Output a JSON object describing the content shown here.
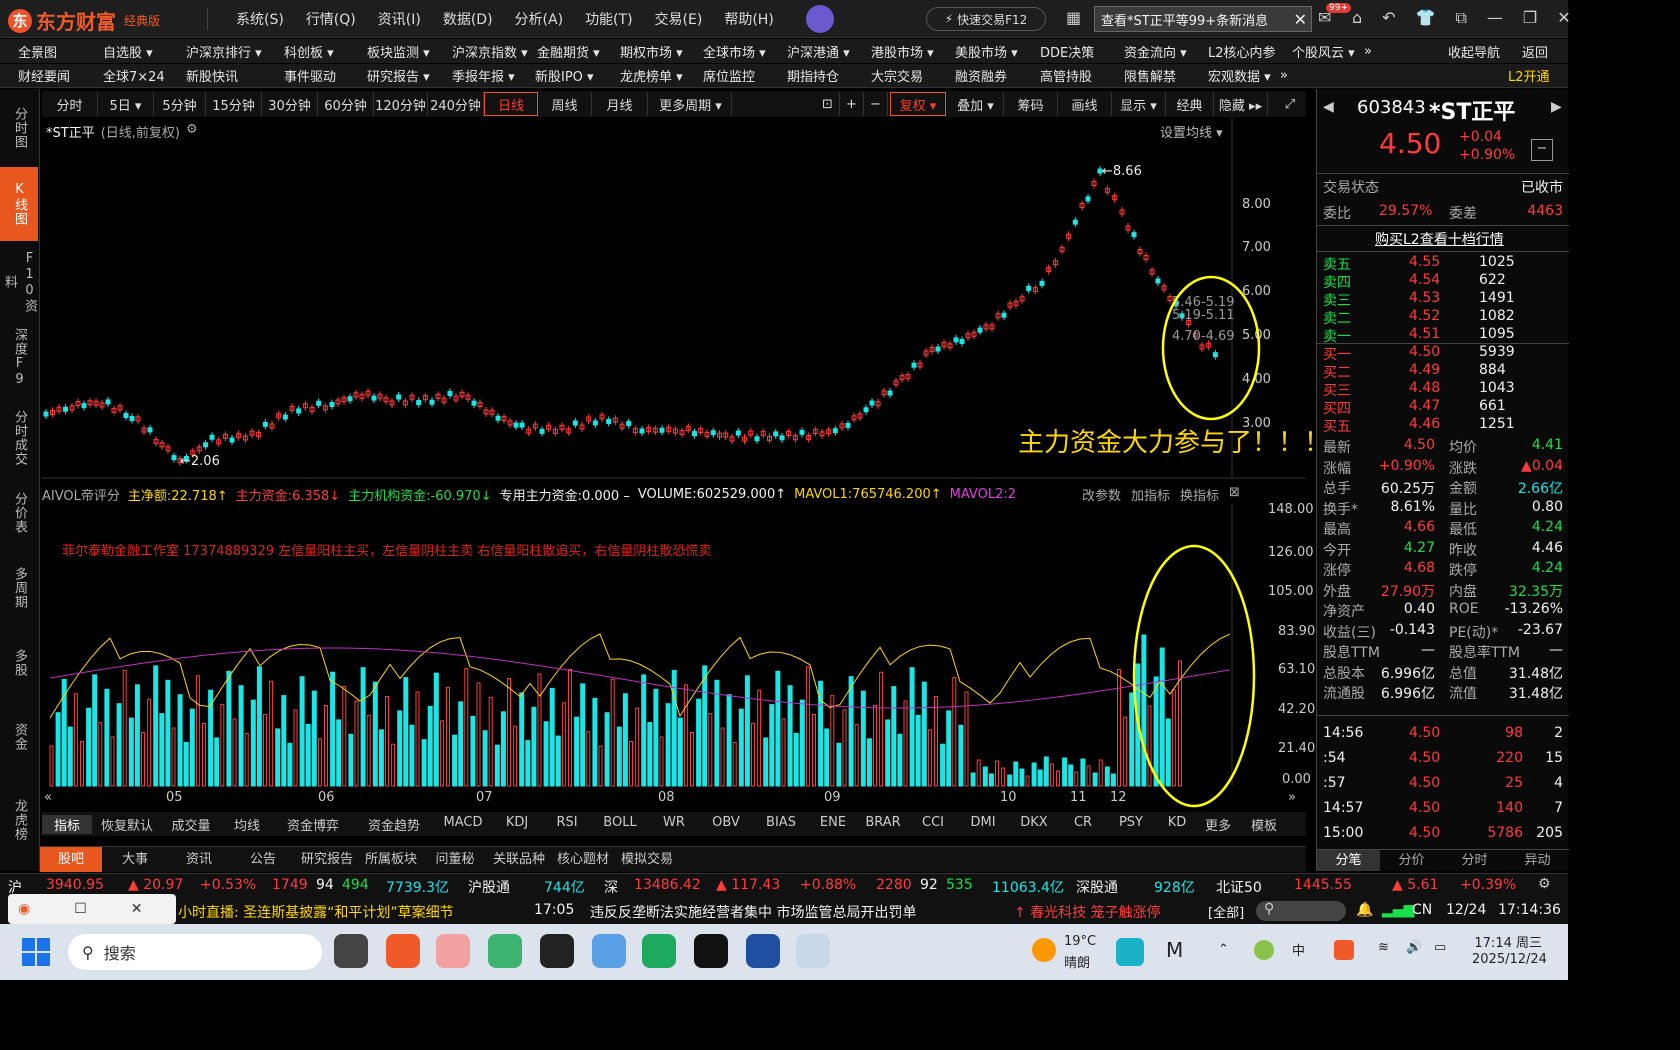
{
  "app": {
    "brand": "东方财富",
    "edition": "经典版",
    "logo_char": "东"
  },
  "menu": [
    "系统(S)",
    "行情(Q)",
    "资讯(I)",
    "数据(D)",
    "分析(A)",
    "功能(T)",
    "交易(E)",
    "帮助(H)"
  ],
  "quick_trade": "快速交易F12",
  "news_button": "查看*ST正平等99+条新消息",
  "mail_badge": "99+",
  "nav_row1": [
    "全景图",
    "自选股 ▾",
    "沪深京排行 ▾",
    "科创板 ▾",
    "板块监测 ▾",
    "沪深京指数 ▾",
    "金融期货 ▾",
    "期权市场 ▾",
    "全球市场 ▾",
    "沪深港通 ▾",
    "港股市场 ▾",
    "美股市场 ▾",
    "DDE决策",
    "资金流向 ▾",
    "L2核心内参",
    "个股风云 ▾",
    "»",
    "收起导航",
    "返回"
  ],
  "nav_row2": [
    "财经要闻",
    "全球7×24",
    "新股快讯",
    "事件驱动",
    "研究报告 ▾",
    "季报年报 ▾",
    "新股IPO ▾",
    "龙虎榜单 ▾",
    "席位监控",
    "期指持仓",
    "大宗交易",
    "融资融券",
    "高管持股",
    "限售解禁",
    "宏观数据 ▾",
    "»",
    "L2开通"
  ],
  "left_sidebar": [
    "分时图",
    "K线图",
    "F10资料",
    "深度F9",
    "分时成交",
    "分价表",
    "多周期",
    "多股",
    "资金",
    "龙虎榜"
  ],
  "period_bar": [
    "分时",
    "5日 ▾",
    "5分钟",
    "15分钟",
    "30分钟",
    "60分钟",
    "120分钟",
    "240分钟",
    "日线",
    "周线",
    "月线",
    "更多周期 ▾"
  ],
  "tool_bar": [
    "复权 ▾",
    "叠加 ▾",
    "筹码",
    "画线",
    "显示 ▾",
    "经典",
    "隐藏 ▸▸"
  ],
  "chart_header": {
    "name": "*ST正平",
    "mode": "(日线,前复权)",
    "ma_setting": "设置均线 ▾"
  },
  "kline": {
    "high_label": "8.66",
    "low_label": "2.06",
    "price_ticks": [
      "8.00",
      "7.00",
      "6.00",
      "5.00",
      "4.00",
      "3.00"
    ],
    "box_labels": [
      "5.46-5.19",
      "5.19-5.11",
      "4.70-4.69"
    ],
    "annotation": "主力资金大力参与了！！！！！"
  },
  "indicator": {
    "name": "AIVOL帝评分",
    "items": [
      {
        "label": "主净额:22.718↑",
        "color": "#ffd700"
      },
      {
        "label": "主力资金:6.358↓",
        "color": "#ff3b3b"
      },
      {
        "label": "主力机构资金:-60.970↓",
        "color": "#18e04a"
      },
      {
        "label": "专用主力资金:0.000 –",
        "color": "#f2f2f2"
      },
      {
        "label": "VOLUME:602529.000↑",
        "color": "#f2f2f2"
      },
      {
        "label": "MAVOL1:765746.200↑",
        "color": "#ffd700"
      },
      {
        "label": "MAVOL2:2",
        "color": "#e63ce6"
      }
    ],
    "actions": [
      "改参数",
      "加指标",
      "换指标"
    ],
    "watermark": "菲尔泰勒金融工作室 17374889329 左信量阳柱主买，左信量阴柱主卖 右信量阳柱散追买，右信量阴柱散恐慌卖",
    "vol_ticks": [
      "148.00",
      "126.00",
      "105.00",
      "83.90",
      "63.10",
      "42.20",
      "21.40",
      "0.00"
    ],
    "month_labels": [
      "05",
      "06",
      "07",
      "08",
      "09",
      "10",
      "11",
      "12"
    ]
  },
  "indicator_tabs": [
    "指标",
    "恢复默认",
    "成交量",
    "均线",
    "资金博弈",
    "资金趋势",
    "MACD",
    "KDJ",
    "RSI",
    "BOLL",
    "WR",
    "OBV",
    "BIAS",
    "ENE",
    "BRAR",
    "CCI",
    "DMI",
    "DKX",
    "CR",
    "PSY",
    "KD",
    "更多",
    "模板"
  ],
  "bottom_tabs": [
    "股吧",
    "大事",
    "资讯",
    "公告",
    "研究报告",
    "所属板块",
    "问董秘",
    "关联品种",
    "核心题材",
    "模拟交易"
  ],
  "quote": {
    "code": "603843",
    "name": "*ST正平",
    "price": "4.50",
    "change": "+0.04",
    "change_pct": "+0.90%",
    "status_label": "交易状态",
    "status": "已收市",
    "weibi_label": "委比",
    "weibi": "29.57%",
    "weicha_label": "委差",
    "weicha": "4463",
    "l2_link": "购买L2查看十档行情",
    "asks": [
      {
        "l": "卖五",
        "p": "4.55",
        "v": "1025"
      },
      {
        "l": "卖四",
        "p": "4.54",
        "v": "622"
      },
      {
        "l": "卖三",
        "p": "4.53",
        "v": "1491"
      },
      {
        "l": "卖二",
        "p": "4.52",
        "v": "1082"
      },
      {
        "l": "卖一",
        "p": "4.51",
        "v": "1095"
      }
    ],
    "bids": [
      {
        "l": "买一",
        "p": "4.50",
        "v": "5939"
      },
      {
        "l": "买二",
        "p": "4.49",
        "v": "884"
      },
      {
        "l": "买三",
        "p": "4.48",
        "v": "1043"
      },
      {
        "l": "买四",
        "p": "4.47",
        "v": "661"
      },
      {
        "l": "买五",
        "p": "4.46",
        "v": "1251"
      }
    ],
    "stats": [
      [
        "最新",
        "4.50",
        "red",
        "均价",
        "4.41",
        "green"
      ],
      [
        "涨幅",
        "+0.90%",
        "red",
        "涨跌",
        "▲0.04",
        "red"
      ],
      [
        "总手",
        "60.25万",
        "white",
        "金额",
        "2.66亿",
        "cyan"
      ],
      [
        "换手*",
        "8.61%",
        "white",
        "量比",
        "0.80",
        "white"
      ],
      [
        "最高",
        "4.66",
        "red",
        "最低",
        "4.24",
        "green"
      ],
      [
        "今开",
        "4.27",
        "green",
        "昨收",
        "4.46",
        "white"
      ],
      [
        "涨停",
        "4.68",
        "red",
        "跌停",
        "4.24",
        "green"
      ],
      [
        "外盘",
        "27.90万",
        "red",
        "内盘",
        "32.35万",
        "green"
      ],
      [
        "净资产",
        "0.40",
        "white",
        "ROE",
        "-13.26%",
        "white"
      ],
      [
        "收益(三)",
        "-0.143",
        "white",
        "PE(动)*",
        "-23.67",
        "white"
      ],
      [
        "股息TTM",
        "—",
        "white",
        "股息率TTM",
        "—",
        "white"
      ],
      [
        "总股本",
        "6.996亿",
        "white",
        "总值",
        "31.48亿",
        "white"
      ],
      [
        "流通股",
        "6.996亿",
        "white",
        "流值",
        "31.48亿",
        "white"
      ]
    ],
    "ticks": [
      [
        "14:56",
        "4.50",
        "98",
        "2"
      ],
      [
        ":54",
        "4.50",
        "220",
        "15"
      ],
      [
        ":57",
        "4.50",
        "25",
        "4"
      ],
      [
        "14:57",
        "4.50",
        "140",
        "7"
      ],
      [
        "15:00",
        "4.50",
        "5786",
        "205"
      ]
    ],
    "tabs": [
      "分笔",
      "分价",
      "分时",
      "异动"
    ]
  },
  "status": {
    "sh_label": "沪",
    "sh_index": "3940.95",
    "sh_chg": "▲ 20.97",
    "sh_pct": "+0.53%",
    "sh_up": "1749",
    "sh_flat": "94",
    "sh_down": "494",
    "sh_amt": "7739.3亿",
    "hgt_label": "沪股通",
    "hgt": "744亿",
    "sz_label": "深",
    "sz_index": "13486.42",
    "sz_chg": "▲ 117.43",
    "sz_pct": "+0.88%",
    "sz_up": "2280",
    "sz_flat": "92",
    "sz_down": "535",
    "sz_amt": "11063.4亿",
    "sgt_label": "深股通",
    "sgt": "928亿",
    "bz_label": "北证50",
    "bz_index": "1445.55",
    "bz_chg": "▲ 5.61",
    "bz_pct": "+0.39%"
  },
  "news": {
    "ticker1": "小时直播: 圣连斯基披露“和平计划”草案细节",
    "time": "17:05",
    "headline": "违反反垄断法实施经营者集中 市场监管总局开出罚单",
    "hot": "↑ 春光科技 笼子触涨停",
    "all": "[全部]",
    "net": "CN",
    "date": "12/24",
    "clock": "17:14:36"
  },
  "taskbar": {
    "search": "搜索",
    "weather_temp": "19°C",
    "weather_desc": "晴朗",
    "time": "17:14 周三",
    "date": "2025/12/24"
  }
}
